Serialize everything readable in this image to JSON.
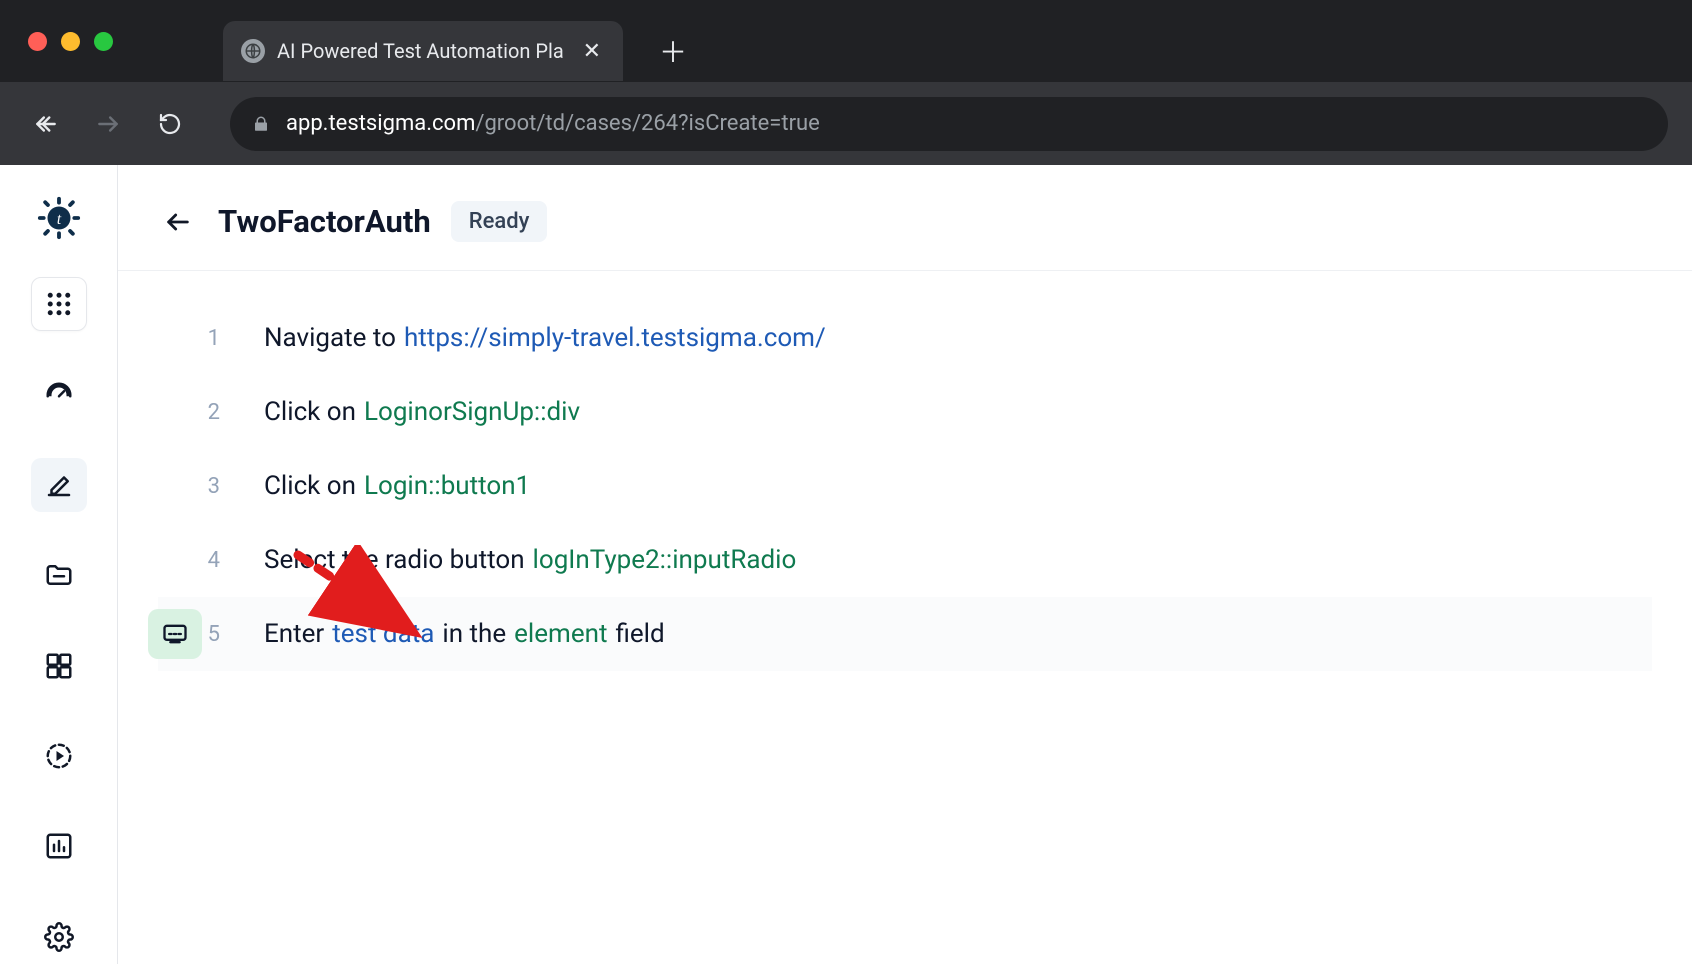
{
  "browser": {
    "tab_title": "AI Powered Test Automation Pla",
    "url_host": "app.testsigma.com",
    "url_path": "/groot/td/cases/264?isCreate=true"
  },
  "header": {
    "page_title": "TwoFactorAuth",
    "status": "Ready"
  },
  "steps": [
    {
      "num": "1",
      "parts": [
        {
          "t": "text",
          "v": "Navigate to"
        },
        {
          "t": "link",
          "v": "https://simply-travel.testsigma.com/"
        }
      ]
    },
    {
      "num": "2",
      "parts": [
        {
          "t": "text",
          "v": "Click on"
        },
        {
          "t": "elem",
          "v": "LoginorSignUp::div"
        }
      ]
    },
    {
      "num": "3",
      "parts": [
        {
          "t": "text",
          "v": "Click on"
        },
        {
          "t": "elem",
          "v": "Login::button1"
        }
      ]
    },
    {
      "num": "4",
      "parts": [
        {
          "t": "text",
          "v": "Select the radio button"
        },
        {
          "t": "elem",
          "v": "logInType2::inputRadio"
        }
      ]
    },
    {
      "num": "5",
      "active": true,
      "parts": [
        {
          "t": "text",
          "v": "Enter"
        },
        {
          "t": "link",
          "v": "test data"
        },
        {
          "t": "text",
          "v": "in the"
        },
        {
          "t": "elem",
          "v": "element"
        },
        {
          "t": "text",
          "v": "field"
        }
      ]
    }
  ]
}
